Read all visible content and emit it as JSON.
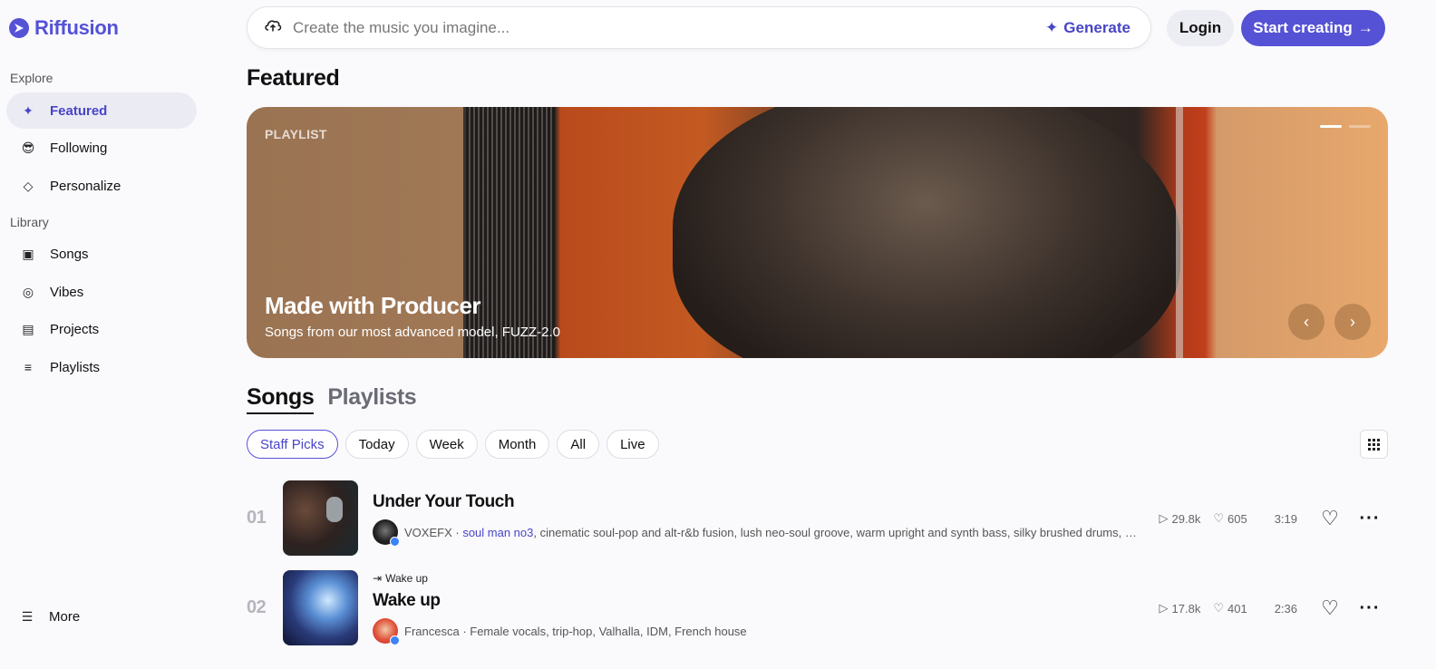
{
  "brand": {
    "name": "Riffusion"
  },
  "sidebar": {
    "explore_label": "Explore",
    "explore_items": [
      {
        "label": "Featured",
        "icon": "sparkle-icon",
        "active": true
      },
      {
        "label": "Following",
        "icon": "sunglasses-icon"
      },
      {
        "label": "Personalize",
        "icon": "diamond-icon"
      }
    ],
    "library_label": "Library",
    "library_items": [
      {
        "label": "Songs",
        "icon": "music-box-icon"
      },
      {
        "label": "Vibes",
        "icon": "flame-icon"
      },
      {
        "label": "Projects",
        "icon": "briefcase-icon"
      },
      {
        "label": "Playlists",
        "icon": "playlist-icon"
      }
    ],
    "more_label": "More"
  },
  "topbar": {
    "search_placeholder": "Create the music you imagine...",
    "generate_label": "Generate",
    "login_label": "Login",
    "start_label": "Start creating"
  },
  "featured": {
    "title": "Featured",
    "banner": {
      "kicker": "PLAYLIST",
      "title": "Made with Producer",
      "subtitle": "Songs from our most advanced model, FUZZ-2.0"
    }
  },
  "tabs": [
    {
      "label": "Songs",
      "active": true
    },
    {
      "label": "Playlists",
      "active": false
    }
  ],
  "filters": [
    {
      "label": "Staff Picks",
      "active": true
    },
    {
      "label": "Today"
    },
    {
      "label": "Week"
    },
    {
      "label": "Month"
    },
    {
      "label": "All"
    },
    {
      "label": "Live"
    }
  ],
  "songs": [
    {
      "rank": "01",
      "title": "Under Your Touch",
      "artist": "VOXEFX",
      "separator": " · ",
      "tag_link": "soul man no3",
      "description": ", cinematic soul-pop and alt-r&b fusion, lush neo-soul groove, warm upright and synth bass, silky brushed drums, smo...",
      "plays": "29.8k",
      "likes": "605",
      "duration": "3:19"
    },
    {
      "rank": "02",
      "remix_of": "Wake up",
      "title": "Wake up",
      "artist": "Francesca",
      "separator": " · ",
      "description": "Female vocals, trip-hop, Valhalla, IDM, French house",
      "plays": "17.8k",
      "likes": "401",
      "duration": "2:36"
    }
  ],
  "colors": {
    "accent": "#5552d6",
    "accent_text": "#4845c7",
    "verified": "#3b82f6"
  }
}
